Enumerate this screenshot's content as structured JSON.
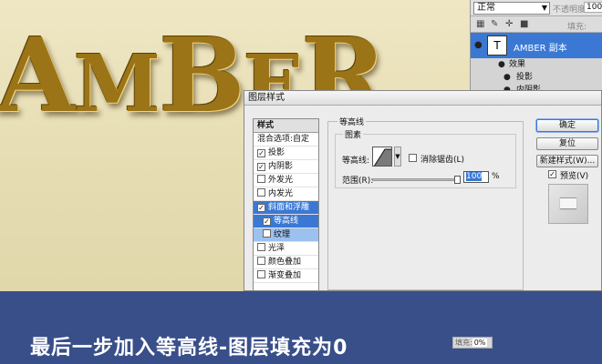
{
  "canvas": {
    "art_text": [
      "A",
      "M",
      "B",
      "E",
      "R"
    ]
  },
  "layers_panel": {
    "blend_mode": "正常",
    "opacity_label": "不透明度:",
    "opacity_value": "100",
    "fill_label": "填充:",
    "layer": {
      "thumb_glyph": "T",
      "name": "AMBER 副本"
    },
    "effects_label": "效果",
    "effects": [
      "投影",
      "内阴影"
    ]
  },
  "dialog": {
    "title": "图层样式",
    "styles_list": [
      {
        "label": "样式",
        "kind": "header"
      },
      {
        "label": "混合选项:自定",
        "kind": "plain"
      },
      {
        "label": "投影",
        "checked": true
      },
      {
        "label": "内阴影",
        "checked": true
      },
      {
        "label": "外发光",
        "checked": false
      },
      {
        "label": "内发光",
        "checked": false
      },
      {
        "label": "斜面和浮雕",
        "checked": true,
        "kind": "selected"
      },
      {
        "label": "等高线",
        "checked": true,
        "kind": "sub-active"
      },
      {
        "label": "纹理",
        "checked": false,
        "kind": "sub"
      },
      {
        "label": "光泽",
        "checked": false
      },
      {
        "label": "颜色叠加",
        "checked": false
      },
      {
        "label": "渐变叠加",
        "checked": false
      }
    ],
    "contour_group_title": "等高线",
    "elements_title": "图素",
    "contour_label": "等高线:",
    "antialias_label": "消除锯齿(L)",
    "antialias_checked": false,
    "range_label": "范围(R):",
    "range_value": "100",
    "range_unit": "%",
    "range_fraction": 1.0,
    "buttons": {
      "ok": "确定",
      "reset": "复位",
      "new_style": "新建样式(W)..."
    },
    "preview_label": "预览(V)",
    "preview_checked": true
  },
  "banner": {
    "caption": "最后一步加入等高线-图层填充为0",
    "fill_label": "填充:",
    "fill_value": "0%"
  },
  "colors": {
    "banner": "#394f8a",
    "selection": "#3a78d4",
    "gold": "#9b7417"
  }
}
